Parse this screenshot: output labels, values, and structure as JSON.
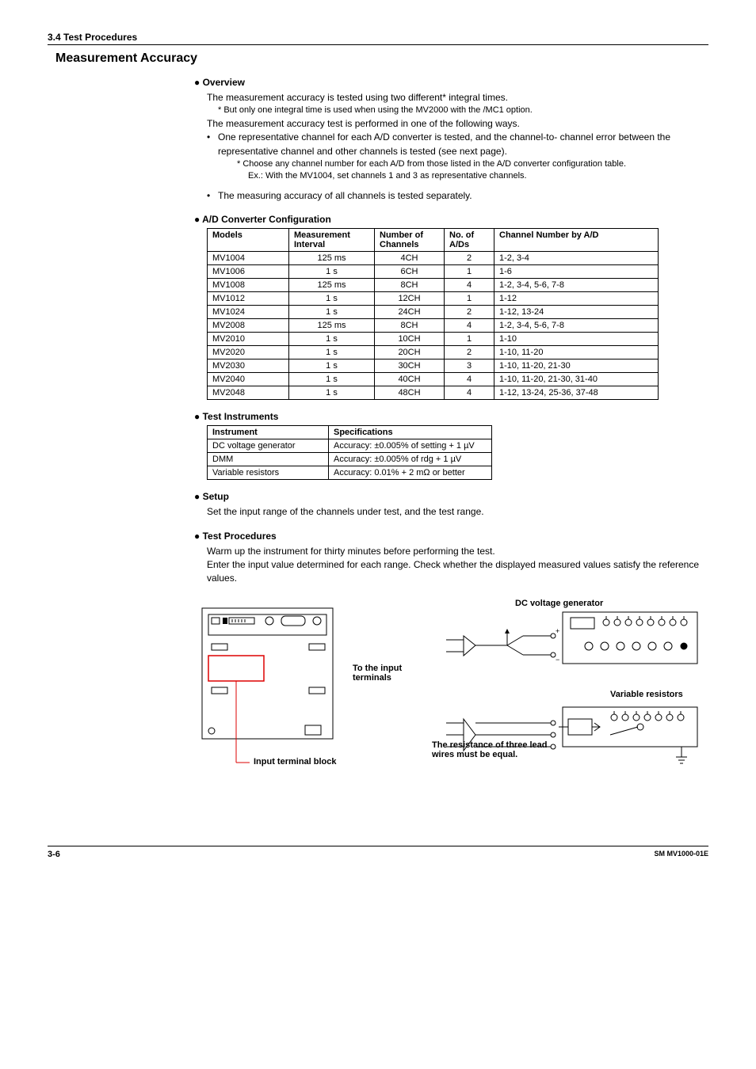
{
  "header": {
    "section_number": "3.4  Test Procedures"
  },
  "main_title": "Measurement Accuracy",
  "overview": {
    "heading": "●  Overview",
    "line1": "The measurement accuracy is tested using two different* integral times.",
    "note1": "*   But only one integral time is used when using the MV2000 with the /MC1 option.",
    "line2": "The measurement accuracy test is performed in one of the following ways.",
    "bullet1a": "One representative channel for each A/D converter is tested, and the channel-to-",
    "bullet1b": "channel error between the representative channel and other channels is tested (see next page).",
    "note2a": "*   Choose any channel number for each A/D from those listed in the A/D converter configuration table.",
    "note2b": "Ex.: With the MV1004, set channels 1 and 3 as representative channels.",
    "bullet2": "The measuring accuracy of all channels is tested separately."
  },
  "adc": {
    "heading": "●  A/D Converter Configuration",
    "th_models": "Models",
    "th_mi": "Measurement Interval",
    "th_ch": "Number of Channels",
    "th_ad": "No. of A/Ds",
    "th_cn": "Channel Number by A/D",
    "rows": [
      {
        "m": "MV1004",
        "mi": "125 ms",
        "ch": "4CH",
        "ad": "2",
        "cn": "1-2, 3-4"
      },
      {
        "m": "MV1006",
        "mi": "1 s",
        "ch": "6CH",
        "ad": "1",
        "cn": "1-6"
      },
      {
        "m": "MV1008",
        "mi": "125 ms",
        "ch": "8CH",
        "ad": "4",
        "cn": "1-2, 3-4, 5-6, 7-8"
      },
      {
        "m": "MV1012",
        "mi": "1 s",
        "ch": "12CH",
        "ad": "1",
        "cn": "1-12"
      },
      {
        "m": "MV1024",
        "mi": "1 s",
        "ch": "24CH",
        "ad": "2",
        "cn": "1-12, 13-24"
      },
      {
        "m": "MV2008",
        "mi": "125 ms",
        "ch": "8CH",
        "ad": "4",
        "cn": "1-2, 3-4, 5-6, 7-8"
      },
      {
        "m": "MV2010",
        "mi": "1 s",
        "ch": "10CH",
        "ad": "1",
        "cn": "1-10"
      },
      {
        "m": "MV2020",
        "mi": "1 s",
        "ch": "20CH",
        "ad": "2",
        "cn": "1-10, 11-20"
      },
      {
        "m": "MV2030",
        "mi": "1 s",
        "ch": "30CH",
        "ad": "3",
        "cn": "1-10, 11-20, 21-30"
      },
      {
        "m": "MV2040",
        "mi": "1 s",
        "ch": "40CH",
        "ad": "4",
        "cn": "1-10, 11-20, 21-30, 31-40"
      },
      {
        "m": "MV2048",
        "mi": "1 s",
        "ch": "48CH",
        "ad": "4",
        "cn": "1-12, 13-24, 25-36, 37-48"
      }
    ]
  },
  "instruments": {
    "heading": "●  Test Instruments",
    "th_inst": "Instrument",
    "th_spec": "Specifications",
    "rows": [
      {
        "i": "DC voltage generator",
        "s": "Accuracy: ±0.005% of setting + 1 µV"
      },
      {
        "i": "DMM",
        "s": "Accuracy: ±0.005% of rdg + 1 µV"
      },
      {
        "i": "Variable resistors",
        "s": "Accuracy: 0.01% + 2 mΩ or better"
      }
    ]
  },
  "setup": {
    "heading": "●  Setup",
    "text": "Set the input range of the channels under test, and the test range."
  },
  "procedures": {
    "heading": "●  Test Procedures",
    "line1": "Warm up the instrument for thirty minutes before performing the test.",
    "line2": "Enter the input value determined for each range. Check whether the displayed measured values satisfy the reference values."
  },
  "diagram": {
    "dc_label": "DC voltage generator",
    "to_input": "To the input terminals",
    "var_res": "Variable resistors",
    "lead_wires": "The resistance of three lead wires must be equal.",
    "input_block": "Input terminal block"
  },
  "footer": {
    "page": "3-6",
    "doc": "SM MV1000-01E"
  }
}
